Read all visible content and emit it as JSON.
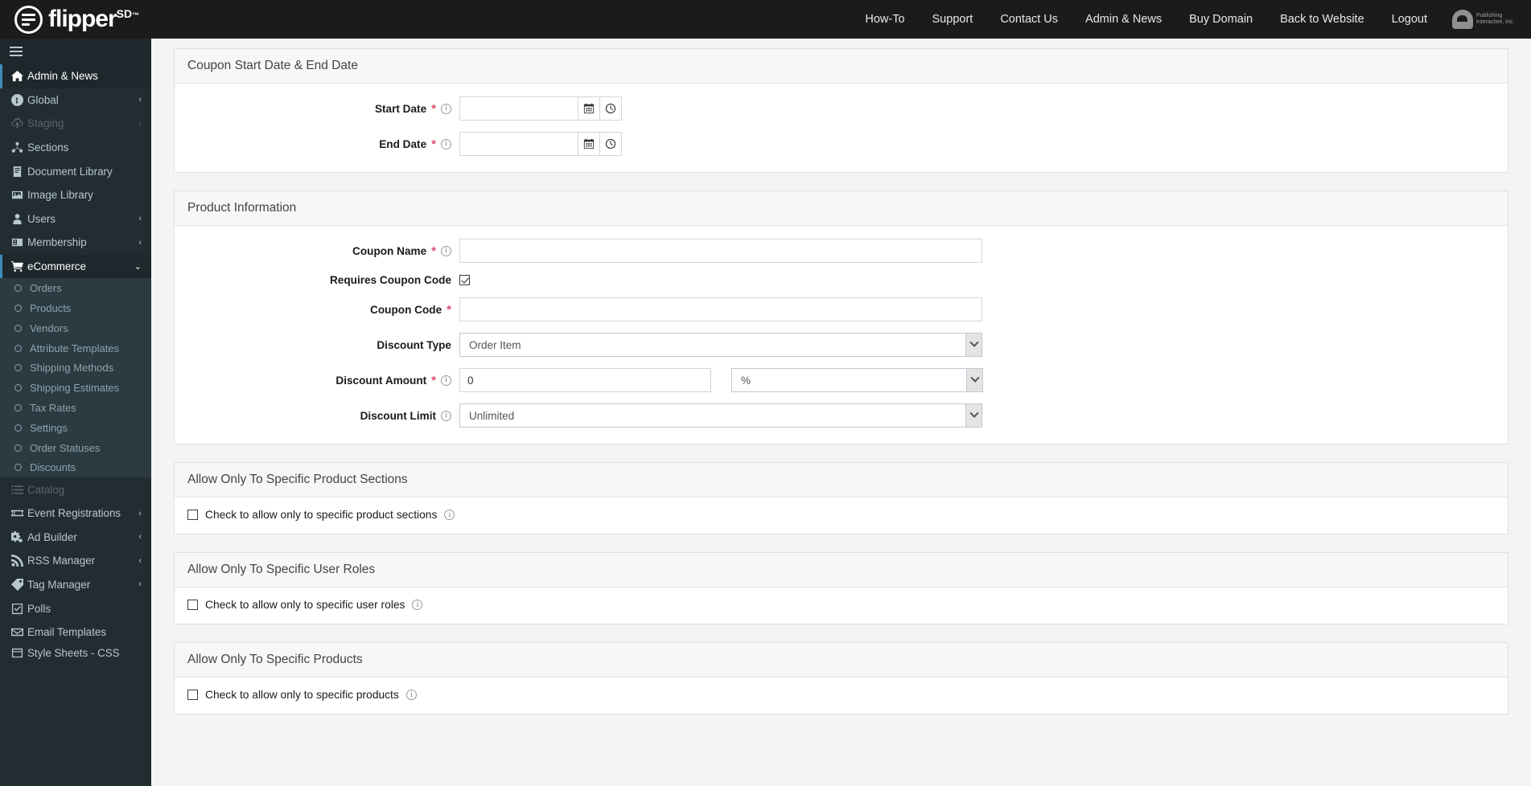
{
  "brand": {
    "word": "flipper",
    "sup": "SD",
    "tm": "™"
  },
  "corp_logo": {
    "line1": "Publishing",
    "line2": "Interactive, Inc."
  },
  "topnav": [
    {
      "label": "How-To"
    },
    {
      "label": "Support"
    },
    {
      "label": "Contact Us"
    },
    {
      "label": "Admin & News"
    },
    {
      "label": "Buy Domain"
    },
    {
      "label": "Back to Website"
    },
    {
      "label": "Logout"
    }
  ],
  "sidebar": {
    "items": [
      {
        "label": "Admin & News",
        "icon": "home-icon",
        "arrow": "",
        "state": "active"
      },
      {
        "label": "Global",
        "icon": "globe-icon",
        "arrow": "‹",
        "state": ""
      },
      {
        "label": "Staging",
        "icon": "cloud-upload-icon",
        "arrow": "‹",
        "state": "dim"
      },
      {
        "label": "Sections",
        "icon": "sitemap-icon",
        "arrow": "",
        "state": ""
      },
      {
        "label": "Document Library",
        "icon": "book-icon",
        "arrow": "",
        "state": ""
      },
      {
        "label": "Image Library",
        "icon": "image-icon",
        "arrow": "",
        "state": ""
      },
      {
        "label": "Users",
        "icon": "user-icon",
        "arrow": "‹",
        "state": ""
      },
      {
        "label": "Membership",
        "icon": "id-card-icon",
        "arrow": "‹",
        "state": ""
      },
      {
        "label": "eCommerce",
        "icon": "cart-icon",
        "arrow": "⌄",
        "state": "open"
      }
    ],
    "ecommerce_sub": [
      {
        "label": "Orders"
      },
      {
        "label": "Products"
      },
      {
        "label": "Vendors"
      },
      {
        "label": "Attribute Templates"
      },
      {
        "label": "Shipping Methods"
      },
      {
        "label": "Shipping Estimates"
      },
      {
        "label": "Tax Rates"
      },
      {
        "label": "Settings"
      },
      {
        "label": "Order Statuses"
      },
      {
        "label": "Discounts"
      }
    ],
    "items_after": [
      {
        "label": "Catalog",
        "icon": "list-icon",
        "arrow": "",
        "state": "dim"
      },
      {
        "label": "Event Registrations",
        "icon": "ticket-icon",
        "arrow": "‹",
        "state": ""
      },
      {
        "label": "Ad Builder",
        "icon": "cogs-icon",
        "arrow": "‹",
        "state": ""
      },
      {
        "label": "RSS Manager",
        "icon": "rss-icon",
        "arrow": "‹",
        "state": ""
      },
      {
        "label": "Tag Manager",
        "icon": "tag-icon",
        "arrow": "‹",
        "state": ""
      },
      {
        "label": "Polls",
        "icon": "check-square-icon",
        "arrow": "",
        "state": ""
      },
      {
        "label": "Email Templates",
        "icon": "envelope-icon",
        "arrow": "",
        "state": ""
      },
      {
        "label": "Style Sheets - CSS",
        "icon": "css-icon",
        "arrow": "",
        "state": "cut"
      }
    ]
  },
  "panels": {
    "dates": {
      "title": "Coupon Start Date & End Date",
      "start_label": "Start Date",
      "start_value": "",
      "end_label": "End Date",
      "end_value": ""
    },
    "product": {
      "title": "Product Information",
      "coupon_name_label": "Coupon Name",
      "coupon_name_value": "",
      "requires_code_label": "Requires Coupon Code",
      "requires_code_checked": true,
      "coupon_code_label": "Coupon Code",
      "coupon_code_value": "",
      "discount_type_label": "Discount Type",
      "discount_type_value": "Order Item",
      "discount_amount_label": "Discount Amount",
      "discount_amount_value": "0",
      "discount_unit_value": "%",
      "discount_limit_label": "Discount Limit",
      "discount_limit_value": "Unlimited"
    },
    "sections": {
      "title": "Allow Only To Specific Product Sections",
      "checkbox_label": "Check to allow only to specific product sections",
      "checked": false
    },
    "roles": {
      "title": "Allow Only To Specific User Roles",
      "checkbox_label": "Check to allow only to specific user roles",
      "checked": false
    },
    "products": {
      "title": "Allow Only To Specific Products",
      "checkbox_label": "Check to allow only to specific products",
      "checked": false
    }
  },
  "colors": {
    "topbar": "#1b1b1b",
    "sidebar": "#222d32",
    "sidebar_sub": "#2c3b41",
    "accent": "#3c8dbc",
    "required": "#dd4b6b",
    "content_bg": "#f4f4f4"
  }
}
